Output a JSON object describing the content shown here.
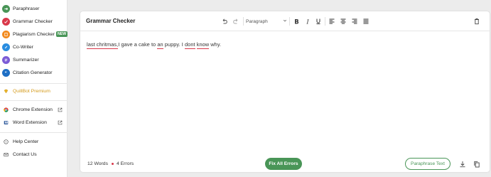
{
  "sidebar": {
    "items": [
      {
        "label": "Paraphraser",
        "icon": "paraphraser-icon",
        "color": "#499557"
      },
      {
        "label": "Grammar Checker",
        "icon": "grammar-checker-icon",
        "color": "#d9384a"
      },
      {
        "label": "Plagiarism Checker",
        "icon": "plagiarism-checker-icon",
        "color": "#f28a1e",
        "badge": "NEW"
      },
      {
        "label": "Co-Writer",
        "icon": "co-writer-icon",
        "color": "#2a8de0"
      },
      {
        "label": "Summarizer",
        "icon": "summarizer-icon",
        "color": "#7b5bd6"
      },
      {
        "label": "Citation Generator",
        "icon": "citation-generator-icon",
        "color": "#1e6fc5"
      }
    ],
    "premium": {
      "label": "QuillBot Premium",
      "icon": "diamond-icon",
      "color": "#d49a1a"
    },
    "extensions": [
      {
        "label": "Chrome Extension",
        "icon": "chrome-icon"
      },
      {
        "label": "Word Extension",
        "icon": "word-icon"
      }
    ],
    "help": [
      {
        "label": "Help Center",
        "icon": "help-icon"
      },
      {
        "label": "Contact Us",
        "icon": "mail-icon"
      }
    ]
  },
  "editor": {
    "title": "Grammar Checker",
    "paragraph_style": "Paragraph",
    "text_segments": [
      {
        "text": "last chritmas,",
        "error": true
      },
      {
        "text": "I gave a cake to ",
        "error": false
      },
      {
        "text": "an",
        "error": true
      },
      {
        "text": " puppy. I ",
        "error": false
      },
      {
        "text": "dont",
        "error": true
      },
      {
        "text": " ",
        "error": false
      },
      {
        "text": "know",
        "error": true
      },
      {
        "text": " why.",
        "error": false
      }
    ]
  },
  "footer": {
    "word_count": "12 Words",
    "error_count": "4 Errors",
    "fix_label": "Fix All Errors",
    "paraphrase_label": "Paraphrase Text"
  },
  "colors": {
    "accent": "#499557",
    "error": "#d9384a",
    "premium": "#d49a1a"
  }
}
